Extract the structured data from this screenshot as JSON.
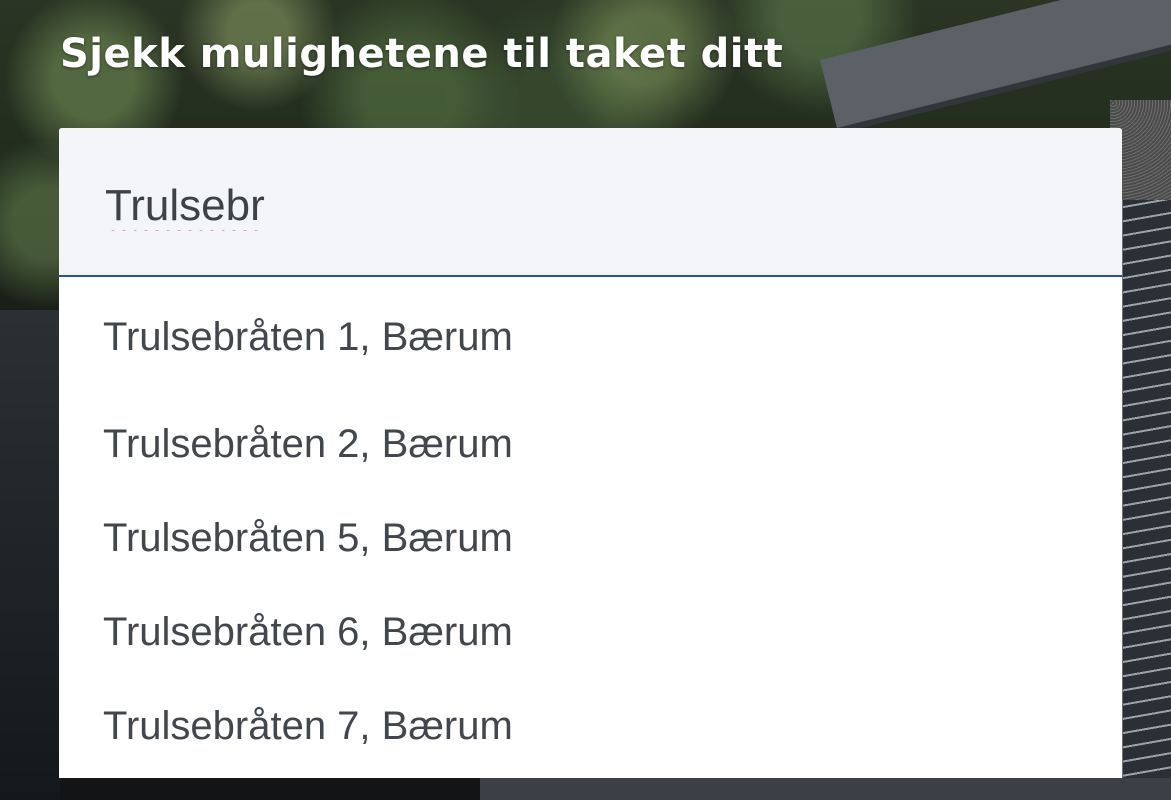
{
  "heading": "Sjekk mulighetene til taket ditt",
  "search": {
    "value": "Trulsebr",
    "spellcheck_flag": true
  },
  "suggestions": [
    "Trulsebråten 1, Bærum",
    "Trulsebråten 2, Bærum",
    "Trulsebråten 5, Bærum",
    "Trulsebråten 6, Bærum",
    "Trulsebråten 7, Bærum"
  ],
  "colors": {
    "heading_text": "#ffffff",
    "input_background": "#f3f5f8",
    "input_underline": "#2b4f9e",
    "suggestion_text": "#42464d",
    "spellcheck_underline": "#e45a5a"
  }
}
